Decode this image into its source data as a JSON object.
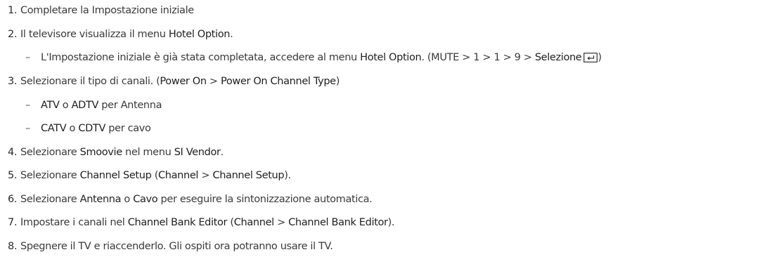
{
  "steps": {
    "s1": {
      "num": "1.",
      "text": "Completare la Impostazione iniziale"
    },
    "s2": {
      "num": "2.",
      "text_a": "Il televisore visualizza il menu ",
      "b1": "Hotel Option",
      "text_b": "."
    },
    "s2_sub": {
      "dash": "–",
      "text_a": "L'Impostazione iniziale è già stata completata, accedere al menu ",
      "b1": "Hotel Option",
      "text_b": ". (MUTE > 1 > 1 > 9 > ",
      "b2": "Selezione",
      "text_c": ")"
    },
    "s3": {
      "num": "3.",
      "text_a": "Selezionare il tipo di canali. (",
      "b1": "Power On",
      "text_b": " > ",
      "b2": "Power On Channel Type",
      "text_c": ")"
    },
    "s3_sub1": {
      "dash": "–",
      "b1": "ATV",
      "text_a": " o ",
      "b2": "ADTV",
      "text_b": " per Antenna"
    },
    "s3_sub2": {
      "dash": "–",
      "b1": "CATV",
      "text_a": " o ",
      "b2": "CDTV",
      "text_b": " per cavo"
    },
    "s4": {
      "num": "4.",
      "text_a": "Selezionare ",
      "b1": "Smoovie",
      "text_b": " nel menu ",
      "b2": "SI Vendor",
      "text_c": "."
    },
    "s5": {
      "num": "5.",
      "text_a": "Selezionare ",
      "b1": "Channel Setup",
      "text_b": " (",
      "b2": "Channel",
      "text_c": " > ",
      "b3": "Channel Setup",
      "text_d": ")."
    },
    "s6": {
      "num": "6.",
      "text_a": "Selezionare ",
      "b1": "Antenna",
      "text_b": " o ",
      "b2": "Cavo",
      "text_c": " per eseguire la sintonizzazione automatica."
    },
    "s7": {
      "num": "7.",
      "text_a": "Impostare i canali nel ",
      "b1": "Channel Bank Editor",
      "text_b": " (",
      "b2": "Channel",
      "text_c": " > ",
      "b3": "Channel Bank Editor",
      "text_d": ")."
    },
    "s8": {
      "num": "8.",
      "text": "Spegnere il TV e riaccenderlo. Gli ospiti ora potranno usare il TV."
    }
  },
  "icons": {
    "enter": "enter-key-icon"
  }
}
